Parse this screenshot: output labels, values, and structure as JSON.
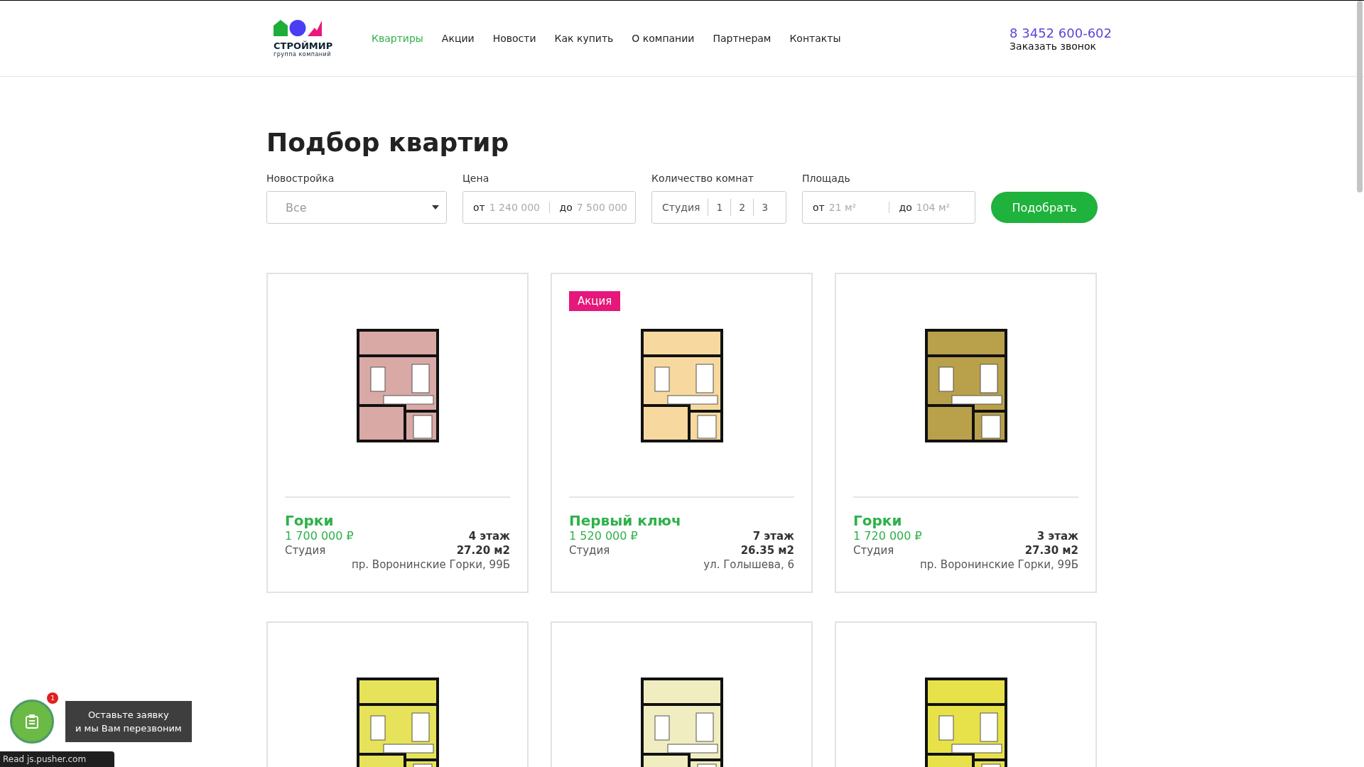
{
  "header": {
    "logo": {
      "name": "СТРОЙМИР",
      "tagline": "группа компаний"
    },
    "nav": [
      {
        "label": "Квартиры",
        "selected": true
      },
      {
        "label": "Акции",
        "selected": false
      },
      {
        "label": "Новости",
        "selected": false
      },
      {
        "label": "Как купить",
        "selected": false
      },
      {
        "label": "О компании",
        "selected": false
      },
      {
        "label": "Партнерам",
        "selected": false
      },
      {
        "label": "Контакты",
        "selected": false
      }
    ],
    "phone": "8 3452 600-602",
    "callback": "Заказать звонок"
  },
  "title": "Подбор квартир",
  "filters": {
    "building": {
      "label": "Новостройка",
      "value": "Все"
    },
    "price": {
      "label": "Цена",
      "from_prefix": "от",
      "from_placeholder": "1 240 000",
      "to_prefix": "до",
      "to_placeholder": "7 500 000"
    },
    "rooms": {
      "label": "Количество комнат",
      "options": [
        {
          "label": "Студия",
          "selected": false
        },
        {
          "label": "1",
          "selected": false
        },
        {
          "label": "2",
          "selected": false
        },
        {
          "label": "3",
          "selected": false
        }
      ]
    },
    "area": {
      "label": "Площадь",
      "from_prefix": "от",
      "from_placeholder": "21 м²",
      "to_prefix": "до",
      "to_placeholder": "104 м²"
    },
    "submit": "Подобрать"
  },
  "cards": [
    {
      "color": "#d9a9a6",
      "name": "Горки",
      "price": "1 700 000 ₽",
      "type": "Студия",
      "floor": "4 этаж",
      "area": "27.20 м2",
      "address": "пр. Воронинские Горки, 99Б"
    },
    {
      "color": "#f7d9a0",
      "badge": "Акция",
      "name": "Первый ключ",
      "price": "1 520 000 ₽",
      "type": "Студия",
      "floor": "7 этаж",
      "area": "26.35 м2",
      "address": "ул. Голышева, 6"
    },
    {
      "color": "#b9a04a",
      "name": "Горки",
      "price": "1 720 000 ₽",
      "type": "Студия",
      "floor": "3 этаж",
      "area": "27.30 м2",
      "address": "пр. Воронинские Горки, 99Б"
    },
    {
      "color": "#e6e35a"
    },
    {
      "color": "#f0eec0"
    },
    {
      "color": "#e8e24a"
    }
  ],
  "widget": {
    "text": "Оставьте заявку\nи мы Вам перезвоним",
    "badge": "1"
  },
  "status_bar": "Read js.pusher.com"
}
